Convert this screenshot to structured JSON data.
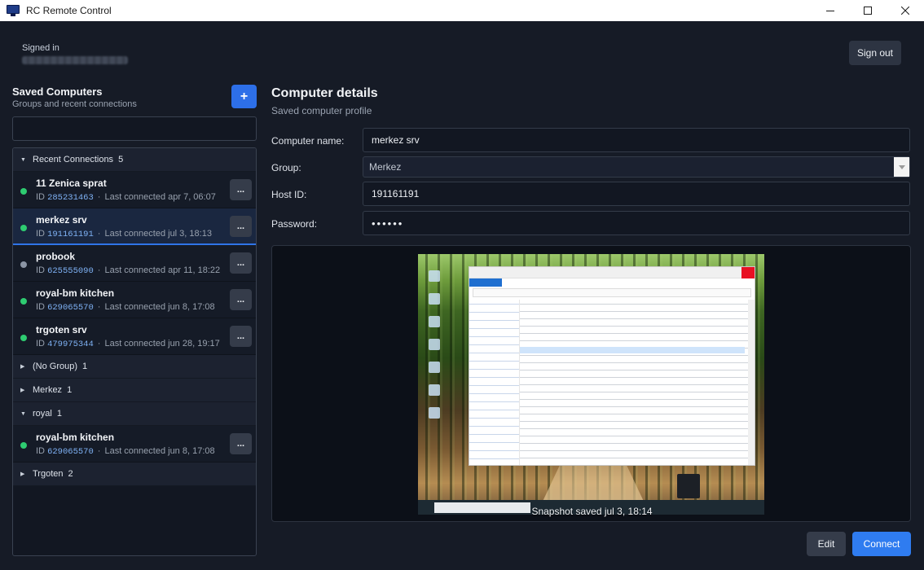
{
  "window": {
    "title": "RC Remote Control",
    "icon": "monitor-icon"
  },
  "account": {
    "label": "Signed in",
    "sign_out": "Sign out"
  },
  "saved": {
    "title": "Saved Computers",
    "subtitle": "Groups and recent connections",
    "add_label": "+",
    "search_value": ""
  },
  "tree": {
    "recent": {
      "name": "Recent Connections",
      "count": "5"
    },
    "recent_items": [
      {
        "name": "11 Zenica sprat",
        "id_label": "ID",
        "id": "285231463",
        "last": "Last connected apr 7, 06:07",
        "status": "online"
      },
      {
        "name": "merkez srv",
        "id_label": "ID",
        "id": "191161191",
        "last": "Last connected jul 3, 18:13",
        "status": "online",
        "selected": true
      },
      {
        "name": "probook",
        "id_label": "ID",
        "id": "625555090",
        "last": "Last connected apr 11, 18:22",
        "status": "offline"
      },
      {
        "name": "royal-bm kitchen",
        "id_label": "ID",
        "id": "629065570",
        "last": "Last connected jun 8, 17:08",
        "status": "online"
      },
      {
        "name": "trgoten srv",
        "id_label": "ID",
        "id": "479975344",
        "last": "Last connected jun 28, 19:17",
        "status": "online"
      }
    ],
    "groups": [
      {
        "name": "(No Group)",
        "count": "1",
        "expanded": false
      },
      {
        "name": "Merkez",
        "count": "1",
        "expanded": false
      },
      {
        "name": "royal",
        "count": "1",
        "expanded": true
      },
      {
        "name": "Trgoten",
        "count": "2",
        "expanded": false
      }
    ],
    "royal_items": [
      {
        "name": "royal-bm kitchen",
        "id_label": "ID",
        "id": "629065570",
        "last": "Last connected jun 8, 17:08",
        "status": "online"
      }
    ],
    "more_label": "..."
  },
  "details": {
    "title": "Computer details",
    "subtitle": "Saved computer profile",
    "computer_name_label": "Computer name:",
    "computer_name": "merkez srv",
    "group_label": "Group:",
    "group": "Merkez",
    "host_id_label": "Host ID:",
    "host_id": "191161191",
    "password_label": "Password:",
    "password_mask": "••••••",
    "snapshot_caption": "Snapshot saved jul 3, 18:14"
  },
  "actions": {
    "edit": "Edit",
    "connect": "Connect"
  },
  "colors": {
    "accent": "#2f7cf0",
    "online": "#2ecc71",
    "offline": "#8b95a5",
    "background": "#161b26"
  }
}
